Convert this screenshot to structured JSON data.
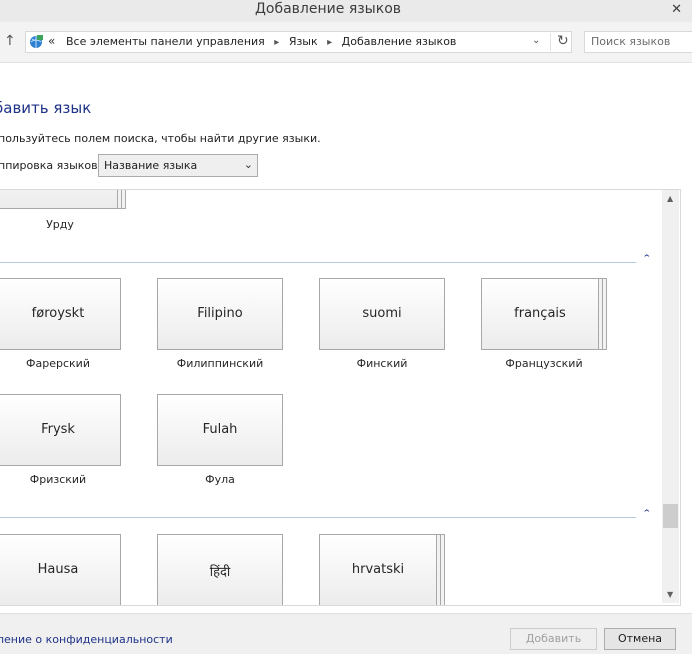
{
  "window": {
    "title": "Добавление языков",
    "close_glyph": "✕"
  },
  "nav": {
    "up_glyph": "↑",
    "address_more": "«",
    "breadcrumbs": [
      "Все элементы панели управления",
      "Язык",
      "Добавление языков"
    ],
    "separator_glyph": "▸",
    "dropdown_glyph": "⌄",
    "refresh_glyph": "↻",
    "search_placeholder": "Поиск языков",
    "icons": {
      "address": "control-panel-globe-icon",
      "search": "search-icon"
    }
  },
  "content": {
    "heading": "бавить язык",
    "hint": "пользуйтесь полем поиска, чтобы найти другие языки.",
    "group_label": "ппировка языков:",
    "group_select": "Название языка",
    "group_select_chevron": "⌄",
    "collapse_glyph": "⌃"
  },
  "languages": {
    "u_row": [
      {
        "caption": "Урду",
        "stacked": true
      }
    ],
    "f_row1": [
      {
        "native": "føroyskt",
        "caption": "Фарерский",
        "stacked": false
      },
      {
        "native": "Filipino",
        "caption": "Филиппинский",
        "stacked": false
      },
      {
        "native": "suomi",
        "caption": "Финский",
        "stacked": false
      },
      {
        "native": "français",
        "caption": "Французский",
        "stacked": true
      }
    ],
    "f_row2": [
      {
        "native": "Frysk",
        "caption": "Фризский",
        "stacked": false
      },
      {
        "native": "Fulah",
        "caption": "Фула",
        "stacked": false
      }
    ],
    "h_row": [
      {
        "native": "Hausa",
        "stacked": false
      },
      {
        "native": "हिंदी",
        "stacked": false
      },
      {
        "native": "hrvatski",
        "stacked": true
      }
    ]
  },
  "scrollbar": {
    "up_glyph": "▲",
    "down_glyph": "▼"
  },
  "footer": {
    "privacy_link": "ление о конфиденциальности",
    "add_button": "Добавить",
    "cancel_button": "Отмена"
  },
  "colors": {
    "accent": "#1e3287",
    "divider": "#b6c9dc",
    "tile_border": "#a8a8a8"
  }
}
